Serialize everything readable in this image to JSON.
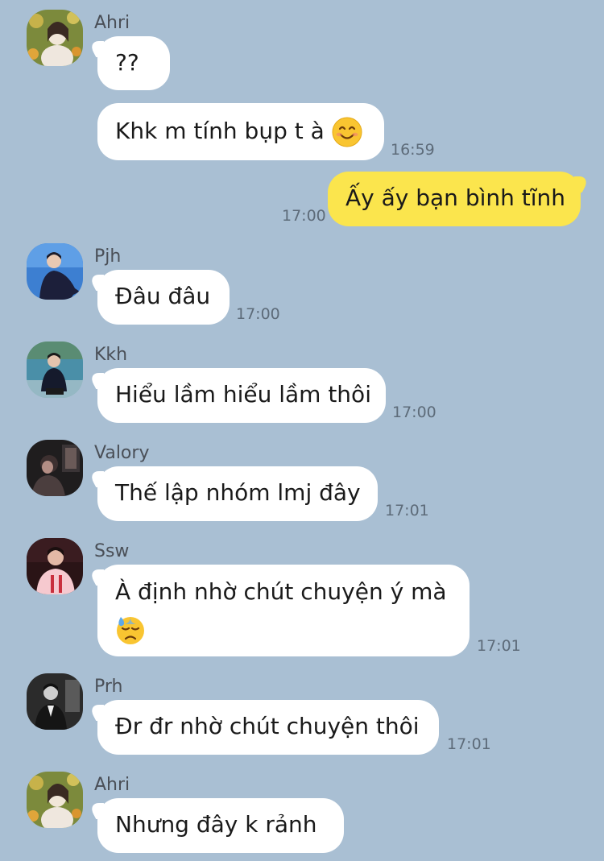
{
  "messages": {
    "m1": {
      "sender": "Ahri",
      "text": "??"
    },
    "m2": {
      "text": "Khk m tính bụp t à",
      "emoji": "smiling-face-icon",
      "time": "16:59"
    },
    "m3": {
      "text": "Ấy ấy bạn bình tĩnh",
      "time": "17:00"
    },
    "m4": {
      "sender": "Pjh",
      "text": "Đâu đâu",
      "time": "17:00"
    },
    "m5": {
      "sender": "Kkh",
      "text": "Hiểu lầm hiểu lầm thôi",
      "time": "17:00"
    },
    "m6": {
      "sender": "Valory",
      "text": "Thế lập nhóm lmj đây",
      "time": "17:01"
    },
    "m7": {
      "sender": "Ssw",
      "text": "À định nhờ chút chuyện ý mà",
      "emoji": "downcast-sweat-face-icon",
      "time": "17:01"
    },
    "m8": {
      "sender": "Prh",
      "text": "Đr đr nhờ chút chuyện thôi",
      "time": "17:01"
    },
    "m9": {
      "sender": "Ahri",
      "text": "Nhưng đây k rảnh"
    }
  },
  "colors": {
    "background": "#a9bfd3",
    "incoming_bubble": "#ffffff",
    "outgoing_bubble": "#fbe54d"
  }
}
